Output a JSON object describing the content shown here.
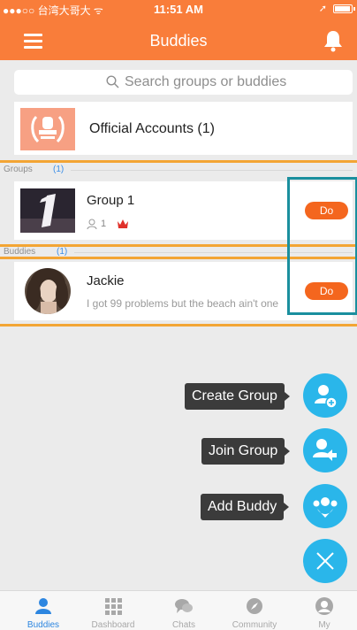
{
  "status": {
    "carrier": "●●●○○ 台湾大哥大 ᯤ",
    "time": "11:51 AM",
    "location": "➚"
  },
  "header": {
    "title": "Buddies"
  },
  "search": {
    "placeholder": "Search groups or buddies"
  },
  "official": {
    "label": "Official Accounts (1)"
  },
  "groups": {
    "header": "Groups",
    "count": "(1)",
    "items": [
      {
        "name": "Group 1",
        "members": "1",
        "action": "Do"
      }
    ]
  },
  "buddies": {
    "header": "Buddies",
    "count": "(1)",
    "items": [
      {
        "name": "Jackie",
        "status": "I got 99 problems but the beach ain't one",
        "action": "Do"
      }
    ]
  },
  "fab_menu": {
    "create_group": "Create Group",
    "join_group": "Join Group",
    "add_buddy": "Add Buddy"
  },
  "tabs": [
    {
      "label": "Buddies",
      "icon": "buddies-icon",
      "active": true
    },
    {
      "label": "Dashboard",
      "icon": "dashboard-icon",
      "active": false
    },
    {
      "label": "Chats",
      "icon": "chats-icon",
      "active": false
    },
    {
      "label": "Community",
      "icon": "compass-icon",
      "active": false
    },
    {
      "label": "My",
      "icon": "profile-icon",
      "active": false
    }
  ],
  "colors": {
    "header": "#f97d3a",
    "accent_blue": "#2ab6ea",
    "action_orange": "#f4661e",
    "tab_active": "#2d86e0"
  }
}
